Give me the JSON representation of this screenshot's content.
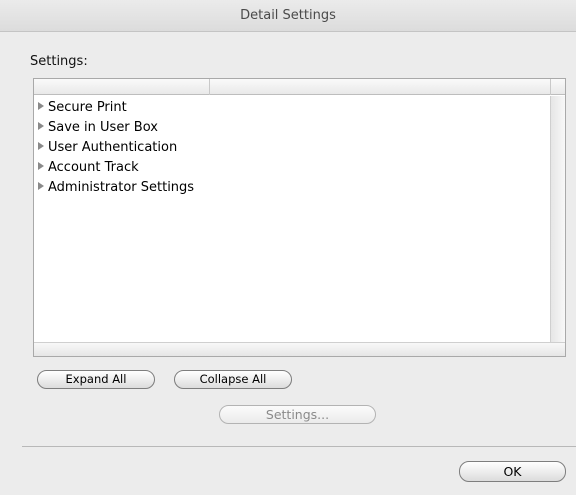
{
  "window": {
    "title": "Detail Settings"
  },
  "settings_label": "Settings:",
  "tree": {
    "items": [
      {
        "label": "Secure Print"
      },
      {
        "label": "Save in User Box"
      },
      {
        "label": "User Authentication"
      },
      {
        "label": "Account Track"
      },
      {
        "label": "Administrator Settings"
      }
    ],
    "expander_icon": "disclosure-triangle-right-icon"
  },
  "buttons": {
    "expand_all": "Expand All",
    "collapse_all": "Collapse All",
    "settings": "Settings...",
    "settings_enabled": false,
    "ok": "OK"
  }
}
